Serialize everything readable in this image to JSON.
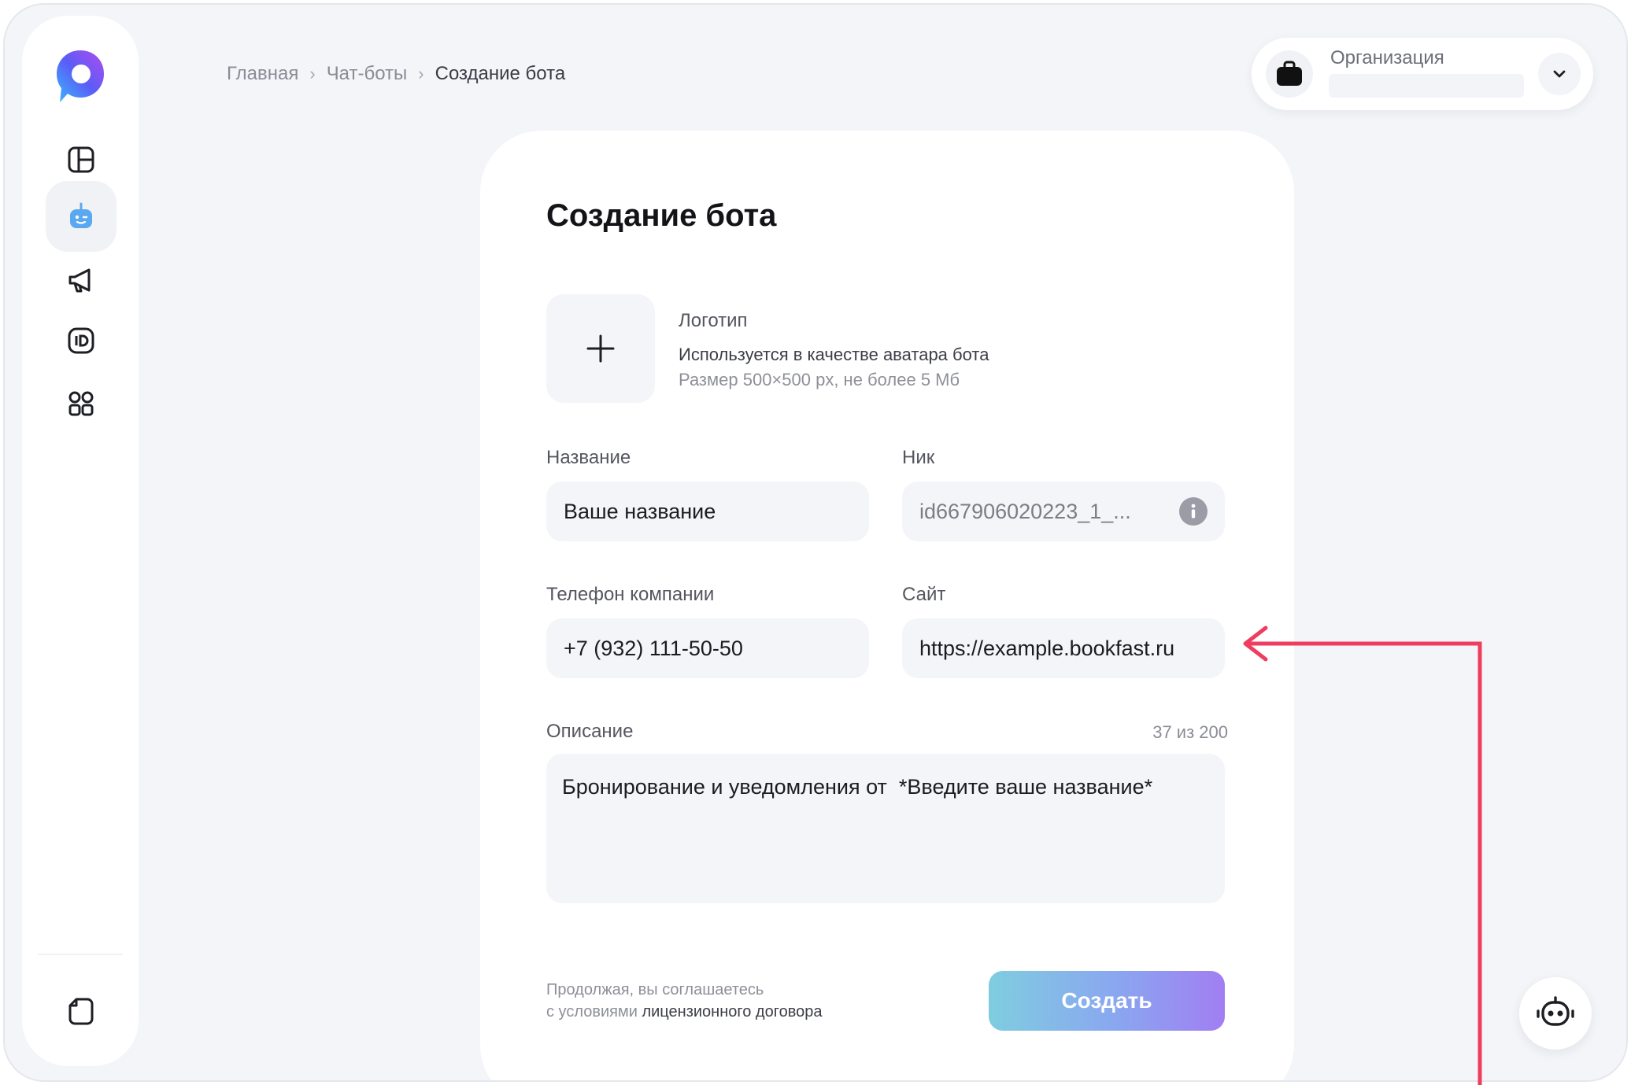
{
  "breadcrumb": {
    "items": [
      "Главная",
      "Чат-боты",
      "Создание бота"
    ]
  },
  "org": {
    "label": "Организация"
  },
  "card": {
    "title": "Создание бота"
  },
  "logo_upload": {
    "label": "Логотип",
    "description": "Используется в качестве аватара бота",
    "hint": "Размер 500×500 px, не более 5 Мб"
  },
  "fields": {
    "name": {
      "label": "Название",
      "placeholder": "Ваше название"
    },
    "nick": {
      "label": "Ник",
      "value": "id667906020223_1_..."
    },
    "phone": {
      "label": "Телефон компании",
      "value": "+7 (932) 111-50-50"
    },
    "site": {
      "label": "Сайт",
      "value": "https://example.bookfast.ru"
    },
    "description": {
      "label": "Описание",
      "counter": "37 из 200",
      "value": "Бронирование и уведомления от  *Введите ваше название*"
    }
  },
  "footer": {
    "terms_line1": "Продолжая, вы соглашаетесь",
    "terms_prefix": "с условиями",
    "terms_link": "лицензионного договора",
    "create_label": "Создать"
  },
  "colors": {
    "accent_gradient_start": "#7fcde0",
    "accent_gradient_end": "#a17ef2",
    "annotation_arrow": "#ef3d5f",
    "active_nav_icon": "#5aa9f0"
  },
  "icons": {
    "sidebar": [
      "dashboard-icon",
      "bot-icon",
      "megaphone-icon",
      "id-icon",
      "apps-icon",
      "document-icon"
    ],
    "org": "briefcase-icon",
    "assistant": "robot-assistant-icon"
  }
}
